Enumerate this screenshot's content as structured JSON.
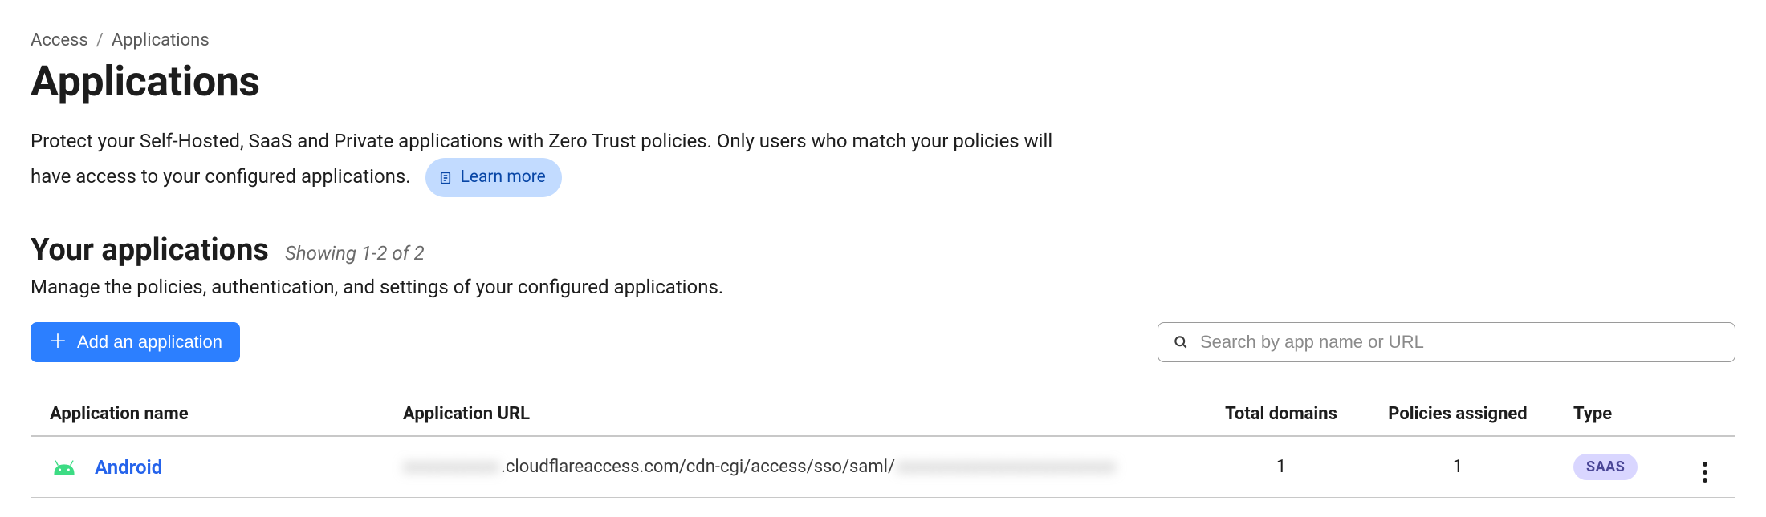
{
  "breadcrumb": {
    "root": "Access",
    "current": "Applications"
  },
  "header": {
    "title": "Applications",
    "description_1": "Protect your Self-Hosted, SaaS and Private applications with Zero Trust policies. Only users who match your policies will have access to your configured applications.",
    "learn_more": "Learn more"
  },
  "section": {
    "title": "Your applications",
    "showing": "Showing 1-2 of 2",
    "subtitle": "Manage the policies, authentication, and settings of your configured applications."
  },
  "actions": {
    "add_button": "Add an application",
    "search_placeholder": "Search by app name or URL"
  },
  "table": {
    "headers": {
      "name": "Application name",
      "url": "Application URL",
      "domains": "Total domains",
      "policies": "Policies assigned",
      "type": "Type"
    },
    "rows": [
      {
        "name": "Android",
        "url_prefix_redacted": "xxxxxxxxxxx",
        "url_mid": ".cloudflareaccess.com/cdn-cgi/access/sso/saml/",
        "url_suffix_redacted": "xxxxxxxxxxxxxxxxxxxxxxxxx",
        "domains": "1",
        "policies": "1",
        "type": "SAAS"
      }
    ]
  }
}
